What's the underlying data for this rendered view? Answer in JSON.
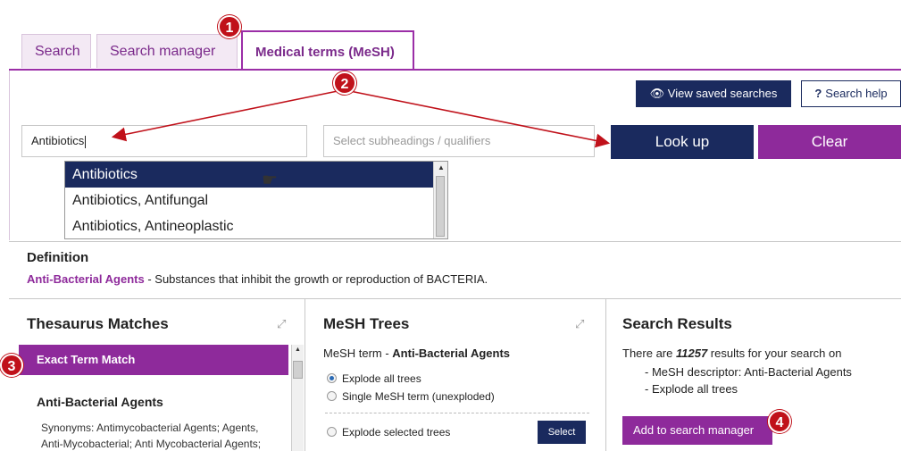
{
  "tabs": [
    {
      "label": "Search"
    },
    {
      "label": "Search manager"
    },
    {
      "label": "Medical terms (MeSH)",
      "active": true
    }
  ],
  "toolbar": {
    "view_saved_label": "View saved searches",
    "search_help_label": "Search help",
    "help_icon_glyph": "?"
  },
  "search": {
    "term_value": "Antibiotics",
    "subheadings_placeholder": "Select subheadings / qualifiers",
    "lookup_label": "Look up",
    "clear_label": "Clear"
  },
  "autocomplete": {
    "items": [
      "Antibiotics",
      "Antibiotics, Antifungal",
      "Antibiotics, Antineoplastic"
    ],
    "selected_index": 0
  },
  "definition": {
    "heading": "Definition",
    "term": "Anti-Bacterial Agents",
    "text": " - Substances that inhibit the growth or reproduction of BACTERIA."
  },
  "thesaurus": {
    "title": "Thesaurus Matches",
    "exact_label": "Exact Term Match",
    "term": "Anti-Bacterial Agents",
    "synonyms": "Synonyms: Antimycobacterial Agents; Agents, Anti-Mycobacterial; Anti Mycobacterial Agents;"
  },
  "mesh_trees": {
    "title": "MeSH Trees",
    "term_prefix": "MeSH term - ",
    "term": "Anti-Bacterial Agents",
    "options": [
      {
        "label": "Explode all trees",
        "checked": true
      },
      {
        "label": "Single MeSH term (unexploded)",
        "checked": false
      },
      {
        "label": "Explode selected trees",
        "checked": false
      }
    ],
    "select_label": "Select"
  },
  "results": {
    "title": "Search Results",
    "prefix": "There are ",
    "count": "11257",
    "suffix": " results for your search on",
    "bullets": [
      "- MeSH descriptor: Anti-Bacterial Agents",
      "- Explode all trees"
    ],
    "add_label": "Add to search manager"
  },
  "callouts": [
    "1",
    "2",
    "3",
    "4"
  ],
  "colors": {
    "brand_purple": "#8e2a9b",
    "navy": "#1a2a5e",
    "callout_red": "#c0111a"
  }
}
